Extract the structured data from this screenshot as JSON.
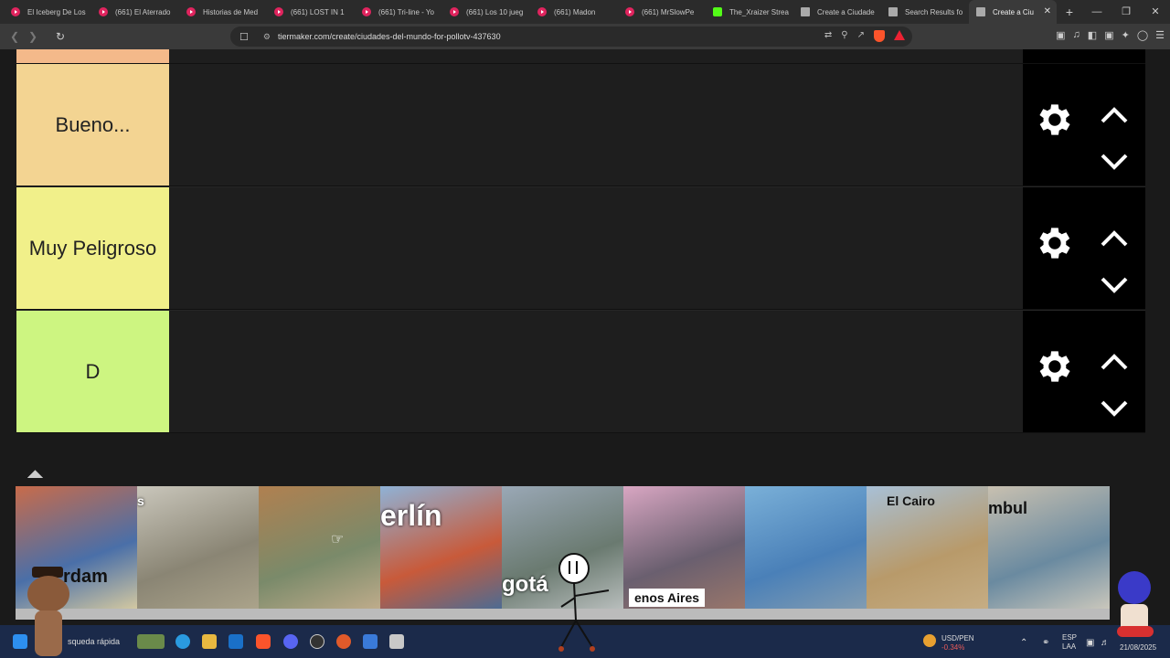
{
  "browser": {
    "tabs": [
      {
        "title": "El Iceberg De Los",
        "icon": "youtube-icon"
      },
      {
        "title": "(661) El Aterrado",
        "icon": "youtube-icon"
      },
      {
        "title": "Historias de Med",
        "icon": "youtube-icon"
      },
      {
        "title": "(661) LOST IN 1",
        "icon": "youtube-icon"
      },
      {
        "title": "(661) Tri-line - Yo",
        "icon": "youtube-icon"
      },
      {
        "title": "(661) Los 10 jueg",
        "icon": "youtube-icon"
      },
      {
        "title": "(661) Madon",
        "icon": "youtube-icon"
      },
      {
        "title": "(661) MrSlowPe",
        "icon": "youtube-icon"
      },
      {
        "title": "The_Xraizer Strea",
        "icon": "kick-icon"
      },
      {
        "title": "Create a Ciudade",
        "icon": "tiermaker-icon"
      },
      {
        "title": "Search Results fo",
        "icon": "tiermaker-icon"
      },
      {
        "title": "Create a Ciu",
        "icon": "tiermaker-icon",
        "active": true
      }
    ],
    "url": "tiermaker.com/create/ciudades-del-mundo-for-pollotv-437630"
  },
  "tiers": [
    {
      "label": "",
      "color": "#f4b98a"
    },
    {
      "label": "Bueno...",
      "color": "#f3d492"
    },
    {
      "label": "Muy Peligroso",
      "color": "#f1f08a"
    },
    {
      "label": "D",
      "color": "#cdf581"
    }
  ],
  "pool": {
    "cards": [
      {
        "label": "rdam",
        "colors": [
          "#c86b4a",
          "#4a6fa8",
          "#e8d6a0"
        ]
      },
      {
        "label": "s",
        "colors": [
          "#c9c6bb",
          "#8a8574",
          "#b0a88e"
        ]
      },
      {
        "label": "",
        "colors": [
          "#b08050",
          "#7a8a6a",
          "#c9b190"
        ]
      },
      {
        "label": "erlín",
        "colors": [
          "#8fb2d6",
          "#c85a3a",
          "#3a6ea0"
        ]
      },
      {
        "label": "gotá",
        "colors": [
          "#9aa8b6",
          "#6a7a70",
          "#c4c8c8"
        ]
      },
      {
        "label": "enos Aires",
        "colors": [
          "#d8a6c2",
          "#6a5f6f",
          "#a07a6a"
        ]
      },
      {
        "label": "",
        "colors": [
          "#7ab0d8",
          "#4a80b8",
          "#8aa0b0"
        ]
      },
      {
        "label": "El Cairo",
        "colors": [
          "#a8c0d6",
          "#b89a6a",
          "#c8b088"
        ]
      },
      {
        "label": "mbul",
        "colors": [
          "#c8c0b0",
          "#6a8aa0",
          "#d8d0c0"
        ]
      }
    ]
  },
  "taskbar": {
    "search_text": "squeda rápida",
    "currency": "USD/PEN",
    "currency_change": "-0.34%",
    "lang_top": "ESP",
    "lang_bottom": "LAA",
    "date": "21/08/2025"
  }
}
